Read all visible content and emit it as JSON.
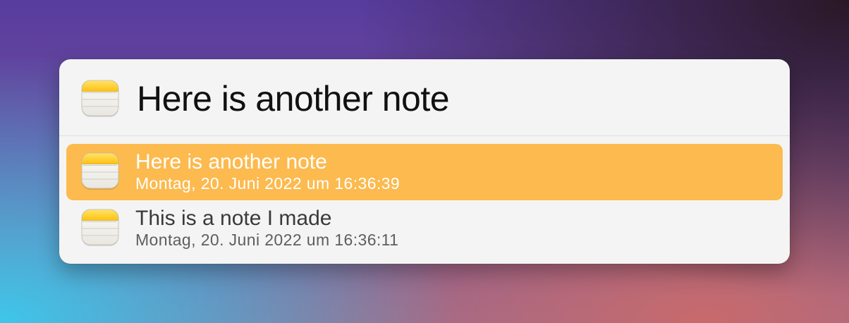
{
  "search": {
    "query": "Here is another note",
    "icon": "notes-app-icon"
  },
  "results": [
    {
      "title": "Here is another note",
      "date": "Montag, 20. Juni 2022 um 16:36:39",
      "icon": "notes-app-icon",
      "selected": true
    },
    {
      "title": "This is a note I made",
      "date": "Montag, 20. Juni 2022 um 16:36:11",
      "icon": "notes-app-icon",
      "selected": false
    }
  ],
  "colors": {
    "selection": "#fcba4f",
    "panel": "#f4f4f4",
    "notes_yellow": "#ffcf21"
  }
}
